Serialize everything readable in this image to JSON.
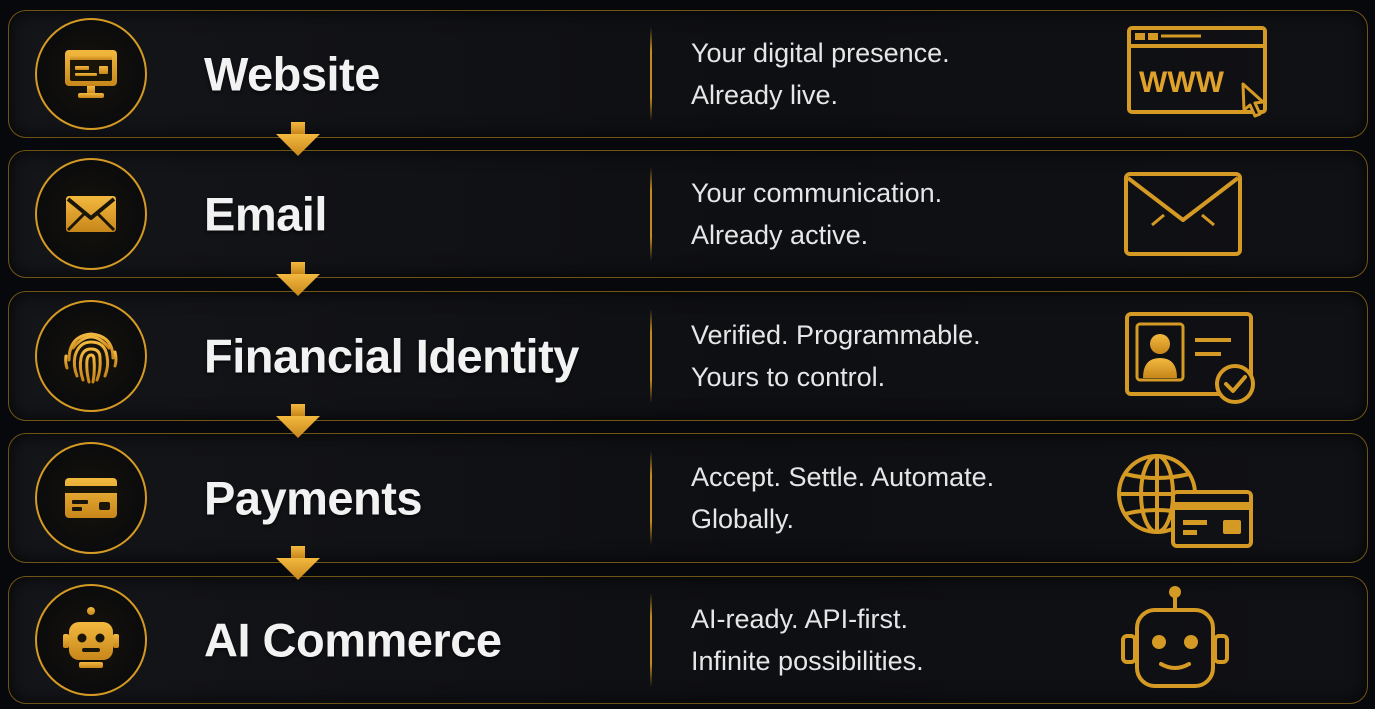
{
  "colors": {
    "accent": "#d59a23",
    "accent_light": "#f0b43a",
    "background": "#07080b",
    "text": "#f2f2f2"
  },
  "rows": [
    {
      "title": "Website",
      "line1": "Your digital presence.",
      "line2": "Already live.",
      "left_icon": "monitor-icon",
      "right_icon": "www-browser-icon",
      "right_label": "WWW"
    },
    {
      "title": "Email",
      "line1": "Your communication.",
      "line2": "Already active.",
      "left_icon": "envelope-icon",
      "right_icon": "envelope-outline-icon"
    },
    {
      "title": "Financial Identity",
      "line1": "Verified. Programmable.",
      "line2": "Yours to control.",
      "left_icon": "fingerprint-icon",
      "right_icon": "id-card-check-icon"
    },
    {
      "title": "Payments",
      "line1": "Accept. Settle. Automate.",
      "line2": "Globally.",
      "left_icon": "credit-card-icon",
      "right_icon": "globe-card-icon"
    },
    {
      "title": "AI Commerce",
      "line1": "AI-ready. API-first.",
      "line2": "Infinite possibilities.",
      "left_icon": "robot-icon",
      "right_icon": "robot-outline-icon"
    }
  ]
}
